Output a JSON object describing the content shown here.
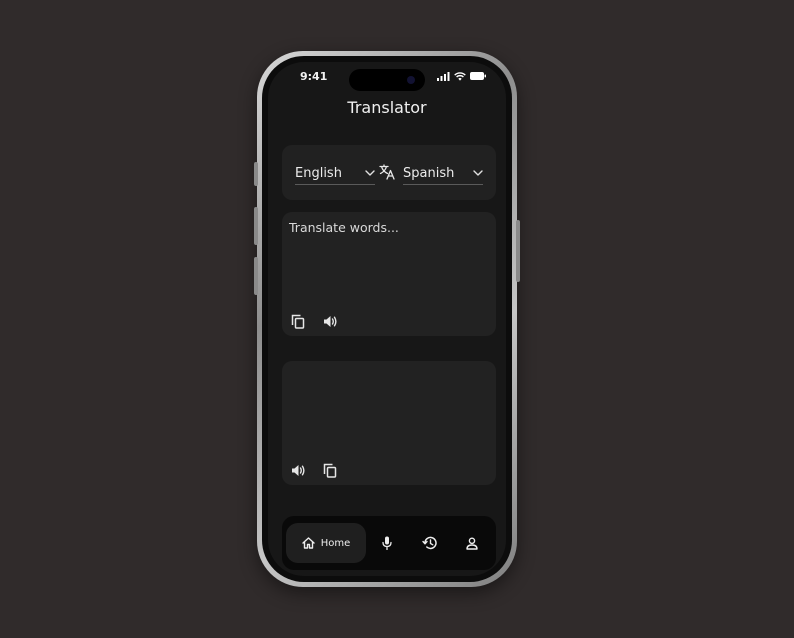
{
  "status_bar": {
    "time": "9:41"
  },
  "header": {
    "title": "Translator"
  },
  "languages": {
    "source": "English",
    "target": "Spanish"
  },
  "input": {
    "placeholder": "Translate words..."
  },
  "nav": {
    "home_label": "Home"
  },
  "icons": {
    "status": [
      "signal-icon",
      "wifi-icon",
      "battery-icon"
    ],
    "swap": "translate-icon",
    "input_actions": [
      "copy-icon",
      "speaker-icon"
    ],
    "output_actions": [
      "speaker-icon",
      "copy-icon"
    ],
    "nav": [
      "home-icon",
      "microphone-icon",
      "history-icon",
      "profile-icon"
    ]
  },
  "colors": {
    "background": "#302b2b",
    "screen": "#171717",
    "card": "#222222",
    "nav": "#090909"
  }
}
